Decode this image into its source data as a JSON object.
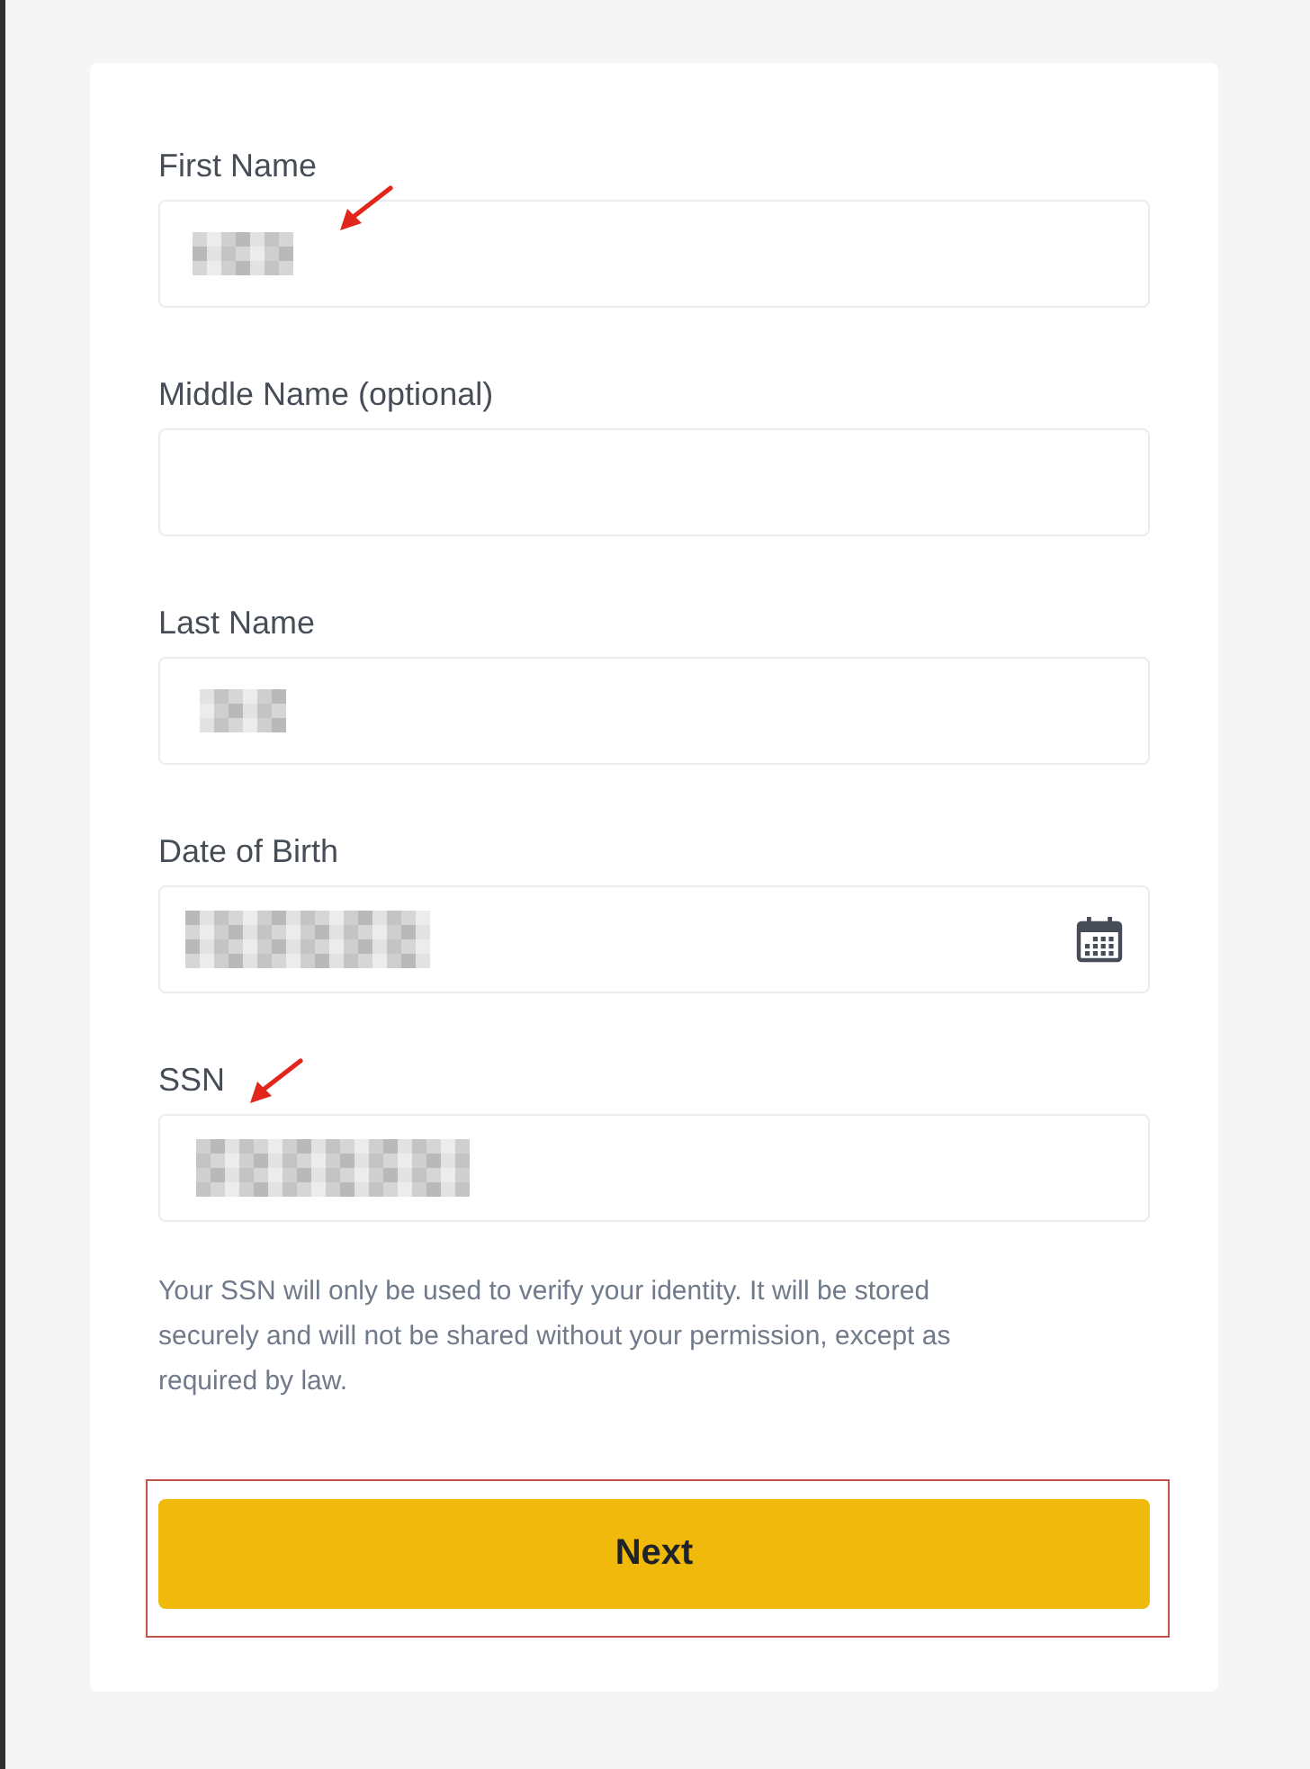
{
  "form": {
    "fields": [
      {
        "label": "First Name",
        "kind": "text",
        "redacted": true,
        "value_arrow": true,
        "label_arrow": false
      },
      {
        "label": "Middle Name (optional)",
        "kind": "text",
        "redacted": false,
        "value_arrow": false,
        "label_arrow": false
      },
      {
        "label": "Last Name",
        "kind": "text",
        "redacted": true,
        "value_arrow": false,
        "label_arrow": false
      },
      {
        "label": "Date of Birth",
        "kind": "date",
        "redacted": true,
        "value_arrow": false,
        "label_arrow": false
      },
      {
        "label": "SSN",
        "kind": "text",
        "redacted": true,
        "value_arrow": false,
        "label_arrow": true
      }
    ],
    "note": "Your SSN will only be used to verify your identity. It will be stored securely and will not be shared without your permission, except as required by law.",
    "submit": {
      "label": "Next",
      "highlighted": true
    }
  }
}
